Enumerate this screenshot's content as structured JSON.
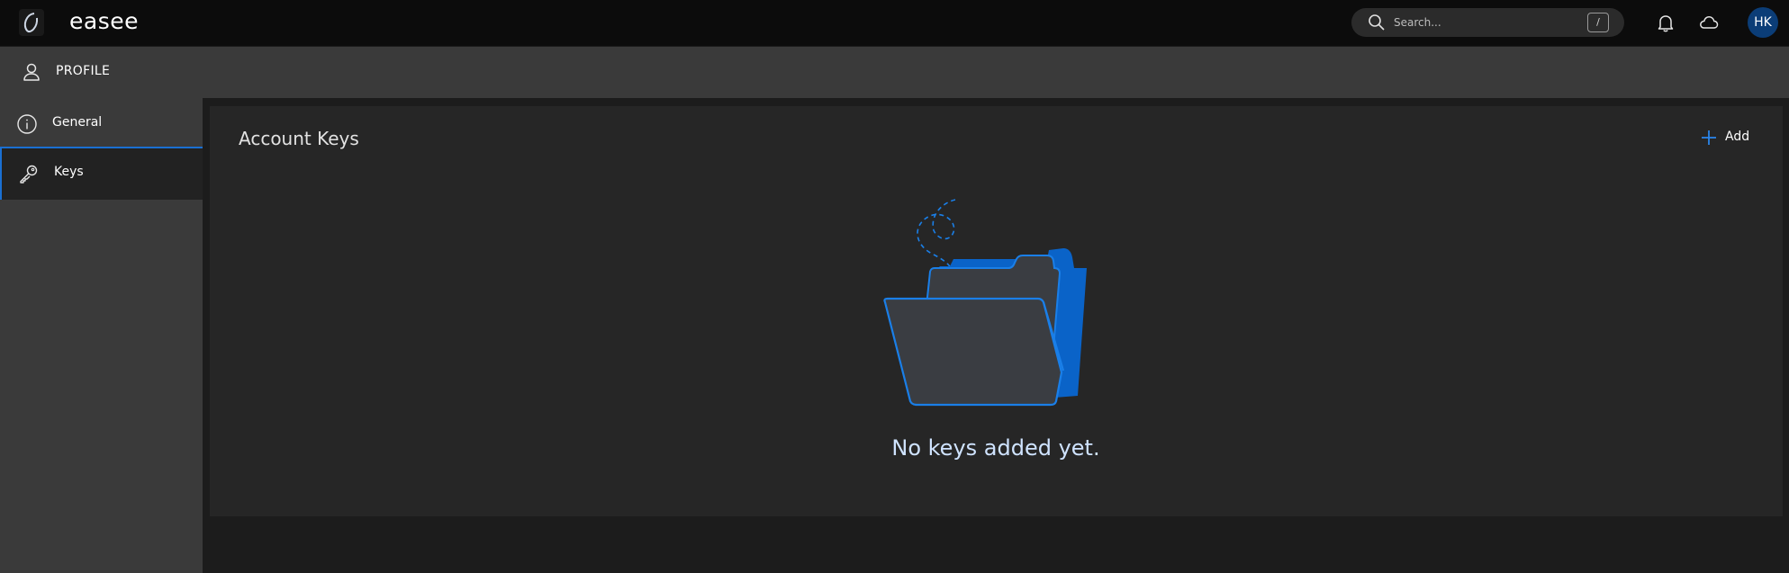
{
  "app": {
    "brand": "easee"
  },
  "header": {
    "search_placeholder": "Search...",
    "search_shortcut": "/",
    "avatar_initials": "HK",
    "icons": [
      "search-icon",
      "bell-icon",
      "cloud-icon"
    ]
  },
  "sidebar": {
    "section_label": "PROFILE",
    "items": [
      {
        "label": "General",
        "icon": "info-icon",
        "active": false
      },
      {
        "label": "Keys",
        "icon": "key-icon",
        "active": true
      }
    ]
  },
  "main": {
    "title": "Account Keys",
    "add_label": "Add",
    "empty_message": "No keys added yet."
  },
  "colors": {
    "accent": "#1a6fd1",
    "topbar": "#0c0c0c",
    "sidebar": "#3a3a3a",
    "card": "#262626"
  }
}
